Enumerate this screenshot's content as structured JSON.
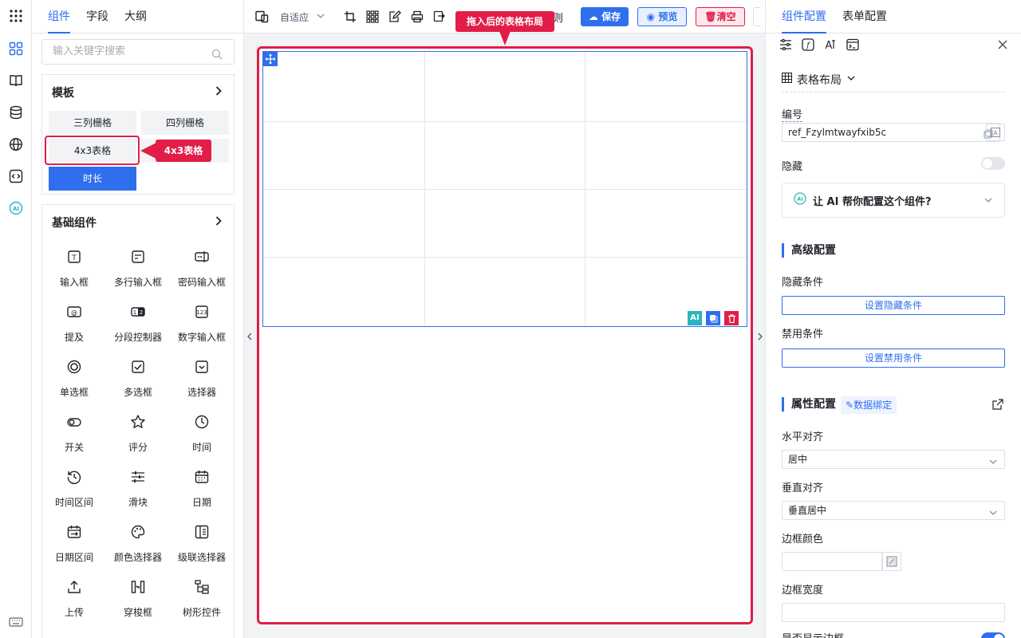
{
  "left_tabs": [
    "组件",
    "字段",
    "大纲"
  ],
  "search": {
    "placeholder": "输入关键字搜索"
  },
  "templates": {
    "title": "模板",
    "items": [
      "三列栅格",
      "四列栅格",
      "4x3表格",
      "",
      "时长"
    ],
    "callout": "4x3表格"
  },
  "basic": {
    "title": "基础组件",
    "items": [
      {
        "label": "输入框",
        "icon": "input-icon"
      },
      {
        "label": "多行输入框",
        "icon": "textarea-icon"
      },
      {
        "label": "密码输入框",
        "icon": "password-icon"
      },
      {
        "label": "提及",
        "icon": "mention-icon"
      },
      {
        "label": "分段控制器",
        "icon": "segmented-icon"
      },
      {
        "label": "数字输入框",
        "icon": "number-icon"
      },
      {
        "label": "单选框",
        "icon": "radio-icon"
      },
      {
        "label": "多选框",
        "icon": "checkbox-icon"
      },
      {
        "label": "选择器",
        "icon": "select-icon"
      },
      {
        "label": "开关",
        "icon": "switch-icon"
      },
      {
        "label": "评分",
        "icon": "star-icon"
      },
      {
        "label": "时间",
        "icon": "clock-icon"
      },
      {
        "label": "时间区间",
        "icon": "history-icon"
      },
      {
        "label": "滑块",
        "icon": "slider-icon"
      },
      {
        "label": "日期",
        "icon": "calendar-icon"
      },
      {
        "label": "日期区间",
        "icon": "date-range-icon"
      },
      {
        "label": "颜色选择器",
        "icon": "palette-icon"
      },
      {
        "label": "级联选择器",
        "icon": "cascader-icon"
      },
      {
        "label": "上传",
        "icon": "upload-icon"
      },
      {
        "label": "穿梭框",
        "icon": "transfer-icon"
      },
      {
        "label": "树形控件",
        "icon": "tree-icon"
      }
    ]
  },
  "toolbar": {
    "layout_mode": "自适应",
    "rules_label": "则",
    "save": "保存",
    "preview": "预览",
    "clear": "清空",
    "callout": "拖入后的表格布局"
  },
  "right_tabs": [
    "组件配置",
    "表单配置"
  ],
  "right": {
    "component_type": "表格布局",
    "id_label": "编号",
    "id_value": "ref_Fzylmtwayfxib5c",
    "hidden_label": "隐藏",
    "ai_prompt": "让 AI 帮你配置这个组件?",
    "advanced_title": "高级配置",
    "hide_cond_label": "隐藏条件",
    "hide_cond_btn": "设置隐藏条件",
    "disable_cond_label": "禁用条件",
    "disable_cond_btn": "设置禁用条件",
    "prop_title": "属性配置",
    "data_binding": "数据绑定",
    "h_align_label": "水平对齐",
    "h_align_value": "居中",
    "v_align_label": "垂直对齐",
    "v_align_value": "垂直居中",
    "border_color_label": "边框颜色",
    "border_width_label": "边框宽度",
    "show_border_label": "是否显示边框"
  },
  "colors": {
    "accent": "#2f6fed",
    "danger": "#e11d48"
  }
}
